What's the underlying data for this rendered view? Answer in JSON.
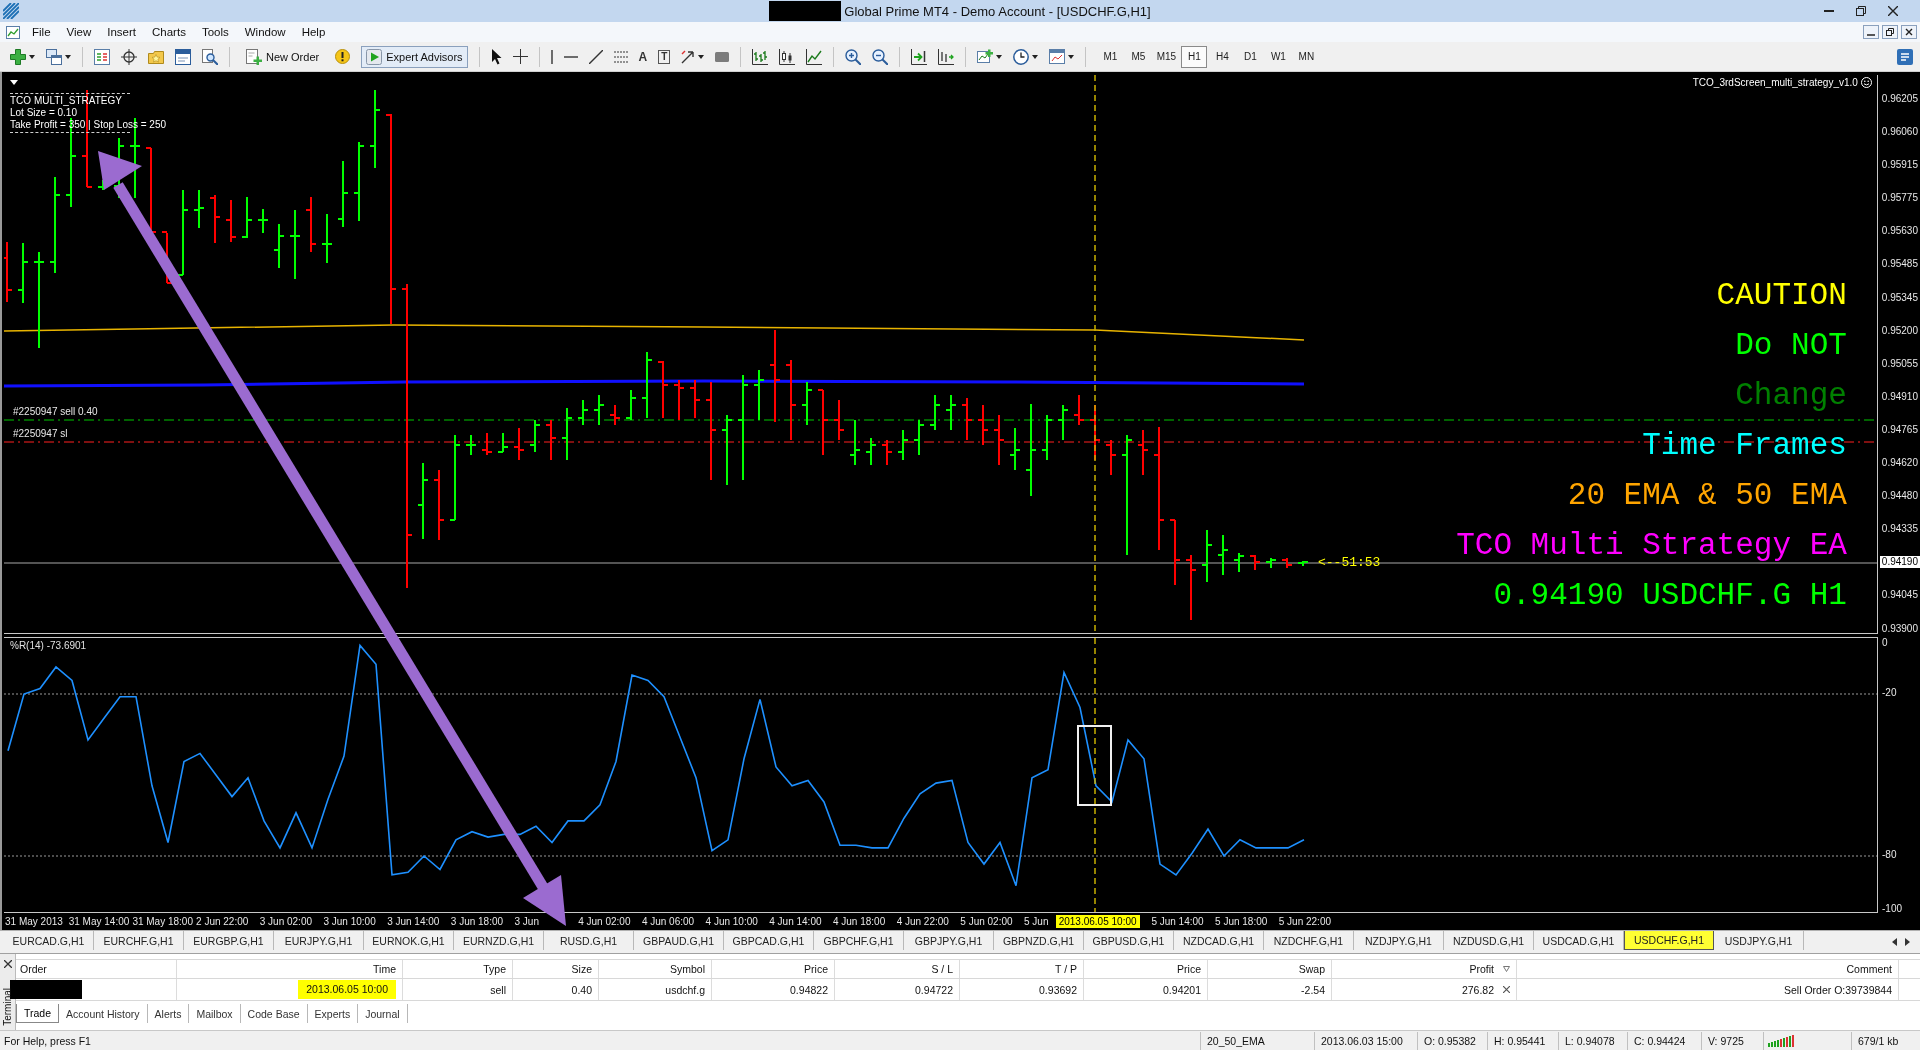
{
  "window": {
    "title": "Global Prime MT4 - Demo Account - [USDCHF.G,H1]",
    "title_redacted": true
  },
  "menu": [
    "File",
    "View",
    "Insert",
    "Charts",
    "Tools",
    "Window",
    "Help"
  ],
  "toolbar": {
    "new_order": "New Order",
    "expert_advisors": {
      "label": "Expert Advisors",
      "on": true
    },
    "text_tool": "A",
    "label_tool": "T",
    "timeframes": [
      {
        "label": "M1",
        "selected": false
      },
      {
        "label": "M5",
        "selected": false
      },
      {
        "label": "M15",
        "selected": false
      },
      {
        "label": "H1",
        "selected": true
      },
      {
        "label": "H4",
        "selected": false
      },
      {
        "label": "D1",
        "selected": false
      },
      {
        "label": "W1",
        "selected": false
      },
      {
        "label": "MN",
        "selected": false
      }
    ]
  },
  "chart": {
    "info_lines": [
      "TCO MULTI_STRATEGY",
      "Lot Size = 0.10",
      "Take Profit = 350 | Stop Loss = 250"
    ],
    "ea_name": "TCO_3rdScreen_multi_strategy_v1.0",
    "trade_lines": [
      {
        "label": "#2250947 sell 0.40",
        "kind": "order"
      },
      {
        "label": "#2250947 sl",
        "kind": "stop_loss"
      }
    ],
    "notes": [
      {
        "text": "CAUTION",
        "color": "#ffff00"
      },
      {
        "text": "Do NOT",
        "color": "#00ff00"
      },
      {
        "text": "Change",
        "color": "#008000"
      },
      {
        "text": "Time Frames",
        "color": "#00ffff"
      },
      {
        "text": "20 EMA & 50 EMA",
        "color": "#ffa500"
      },
      {
        "text": "TCO Multi Strategy EA",
        "color": "#ff00ff"
      },
      {
        "text": "0.94190 USDCHF.G H1",
        "color": "#00ff00"
      }
    ],
    "countdown": "<--51:53",
    "price_axis": [
      {
        "text": "0.96205",
        "kind": "tick"
      },
      {
        "text": "0.96060",
        "kind": "tick"
      },
      {
        "text": "0.95915",
        "kind": "tick"
      },
      {
        "text": "0.95775",
        "kind": "tick"
      },
      {
        "text": "0.95630",
        "kind": "tick"
      },
      {
        "text": "0.95485",
        "kind": "tick"
      },
      {
        "text": "0.95345",
        "kind": "tick"
      },
      {
        "text": "0.95200",
        "kind": "tick"
      },
      {
        "text": "0.95055",
        "kind": "tick"
      },
      {
        "text": "0.94910",
        "kind": "tick"
      },
      {
        "text": "0.94765",
        "kind": "tick"
      },
      {
        "text": "0.94620",
        "kind": "tick"
      },
      {
        "text": "0.94480",
        "kind": "tick"
      },
      {
        "text": "0.94335",
        "kind": "tick"
      },
      {
        "text": "0.94190",
        "kind": "current"
      },
      {
        "text": "0.94045",
        "kind": "tick"
      },
      {
        "text": "0.93900",
        "kind": "tick"
      }
    ],
    "indicator": {
      "chart_data": {
        "type": "line",
        "title": "%R(14) -73.6901",
        "ylim": [
          -100,
          0
        ],
        "yticks": [
          0,
          -20,
          -80,
          -100
        ],
        "series": [
          {
            "color": "#1e90ff",
            "values": [
              -41,
              -20,
              -18,
              -10,
              -15,
              -37,
              -29,
              -21,
              -21,
              -54,
              -75,
              -45,
              -42,
              -50,
              -58,
              -51,
              -67,
              -77,
              -64,
              -77,
              -59,
              -43,
              -2,
              -9,
              -87,
              -86,
              -80,
              -85,
              -74,
              -71,
              -73,
              -72,
              -72,
              -69,
              -75,
              -67,
              -67,
              -61,
              -45,
              -13,
              -15,
              -21,
              -36,
              -51,
              -78,
              -74,
              -44,
              -22,
              -47,
              -54,
              -52,
              -60,
              -76,
              -76,
              -77,
              -77,
              -66,
              -57,
              -53,
              -52,
              -75,
              -83,
              -75,
              -91,
              -51,
              -48,
              -12,
              -25,
              -54,
              -60,
              -37,
              -44,
              -83,
              -87,
              -79,
              -70,
              -80,
              -74,
              -77,
              -77,
              -77,
              -74
            ]
          }
        ]
      }
    },
    "time_axis": [
      {
        "text": "31 May 2013",
        "kind": "tick"
      },
      {
        "text": "31 May 14:00",
        "kind": "tick"
      },
      {
        "text": "31 May 18:00",
        "kind": "tick"
      },
      {
        "text": "2 Jun 22:00",
        "kind": "tick"
      },
      {
        "text": "3 Jun 02:00",
        "kind": "tick"
      },
      {
        "text": "3 Jun 10:00",
        "kind": "tick"
      },
      {
        "text": "3 Jun 14:00",
        "kind": "tick"
      },
      {
        "text": "3 Jun 18:00",
        "kind": "tick"
      },
      {
        "text": "3 Jun",
        "kind": "tick"
      },
      {
        "text": "4 Jun 02:00",
        "kind": "tick"
      },
      {
        "text": "4 Jun 06:00",
        "kind": "tick"
      },
      {
        "text": "4 Jun 10:00",
        "kind": "tick"
      },
      {
        "text": "4 Jun 14:00",
        "kind": "tick"
      },
      {
        "text": "4 Jun 18:00",
        "kind": "tick"
      },
      {
        "text": "4 Jun 22:00",
        "kind": "tick"
      },
      {
        "text": "5 Jun 02:00",
        "kind": "tick"
      },
      {
        "text": "5 Jun",
        "kind": "tick"
      },
      {
        "text": "2013.06.05 10:00",
        "kind": "crosshair"
      },
      {
        "text": "5 Jun 14:00",
        "kind": "tick"
      },
      {
        "text": "5 Jun 18:00",
        "kind": "tick"
      },
      {
        "text": "5 Jun 22:00",
        "kind": "tick"
      }
    ]
  },
  "symbol_tabs": [
    {
      "label": "EURCAD.G,H1",
      "selected": false
    },
    {
      "label": "EURCHF.G,H1",
      "selected": false
    },
    {
      "label": "EURGBP.G,H1",
      "selected": false
    },
    {
      "label": "EURJPY.G,H1",
      "selected": false
    },
    {
      "label": "EURNOK.G,H1",
      "selected": false
    },
    {
      "label": "EURNZD.G,H1",
      "selected": false
    },
    {
      "label": "RUSD.G,H1",
      "selected": false
    },
    {
      "label": "GBPAUD.G,H1",
      "selected": false
    },
    {
      "label": "GBPCAD.G,H1",
      "selected": false
    },
    {
      "label": "GBPCHF.G,H1",
      "selected": false
    },
    {
      "label": "GBPJPY.G,H1",
      "selected": false
    },
    {
      "label": "GBPNZD.G,H1",
      "selected": false
    },
    {
      "label": "GBPUSD.G,H1",
      "selected": false
    },
    {
      "label": "NZDCAD.G,H1",
      "selected": false
    },
    {
      "label": "NZDCHF.G,H1",
      "selected": false
    },
    {
      "label": "NZDJPY.G,H1",
      "selected": false
    },
    {
      "label": "NZDUSD.G,H1",
      "selected": false
    },
    {
      "label": "USDCAD.G,H1",
      "selected": false
    },
    {
      "label": "USDCHF.G,H1",
      "selected": true
    },
    {
      "label": "USDJPY.G,H1",
      "selected": false
    }
  ],
  "terminal": {
    "title": "Terminal",
    "columns": [
      "Order",
      "Time",
      "Type",
      "Size",
      "Symbol",
      "Price",
      "S / L",
      "T / P",
      "Price",
      "Swap",
      "Profit",
      "Comment"
    ],
    "rows": [
      {
        "order_redacted": true,
        "time": "2013.06.05 10:00",
        "time_highlighted": true,
        "type": "sell",
        "size": "0.40",
        "symbol": "usdchf.g",
        "price": "0.94822",
        "sl": "0.94722",
        "tp": "0.93692",
        "current_price": "0.94201",
        "swap": "-2.54",
        "profit": "276.82",
        "comment": "Sell Order O:39739844"
      }
    ],
    "tabs": [
      {
        "label": "Trade",
        "selected": true
      },
      {
        "label": "Account History",
        "selected": false
      },
      {
        "label": "Alerts",
        "selected": false
      },
      {
        "label": "Mailbox",
        "selected": false
      },
      {
        "label": "Code Base",
        "selected": false
      },
      {
        "label": "Experts",
        "selected": false
      },
      {
        "label": "Journal",
        "selected": false
      }
    ]
  },
  "status_bar": {
    "help": "For Help, press F1",
    "fields": [
      "20_50_EMA",
      "2013.06.03 15:00",
      "O: 0.95382",
      "H: 0.95441",
      "L: 0.94078",
      "C: 0.94424",
      "V: 9725"
    ],
    "traffic": "679/1 kb"
  }
}
